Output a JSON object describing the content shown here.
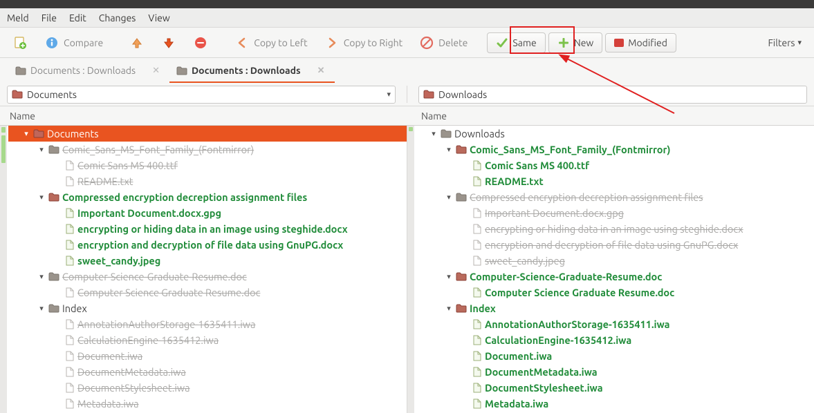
{
  "title": "Documents : Downloads",
  "menu": {
    "meld": "Meld",
    "file": "File",
    "edit": "Edit",
    "changes": "Changes",
    "view": "View"
  },
  "toolbar": {
    "compare": "Compare",
    "copy_left": "Copy to Left",
    "copy_right": "Copy to Right",
    "delete": "Delete",
    "same": "Same",
    "new": "New",
    "modified": "Modified",
    "filters": "Filters"
  },
  "tabs": [
    {
      "label": "Documents : Downloads",
      "active": false
    },
    {
      "label": "Documents : Downloads",
      "active": true
    }
  ],
  "paths": {
    "left": "Documents",
    "right": "Downloads"
  },
  "columns": {
    "name": "Name"
  },
  "left_tree": [
    {
      "depth": 0,
      "type": "folder",
      "exp": "▾",
      "label": "Documents",
      "cls": "rootsel"
    },
    {
      "depth": 1,
      "type": "folder",
      "exp": "▾",
      "label": "Comic_Sans_MS_Font_Family_(Fontmirror)",
      "cls": "ghost"
    },
    {
      "depth": 2,
      "type": "file",
      "exp": "",
      "label": "Comic Sans MS 400.ttf",
      "cls": "ghost"
    },
    {
      "depth": 2,
      "type": "file",
      "exp": "",
      "label": "README.txt",
      "cls": "ghost"
    },
    {
      "depth": 1,
      "type": "folder",
      "exp": "▾",
      "label": "Compressed encryption decreption assignment files",
      "cls": "green"
    },
    {
      "depth": 2,
      "type": "file",
      "exp": "",
      "label": "Important Document.docx.gpg",
      "cls": "green"
    },
    {
      "depth": 2,
      "type": "file",
      "exp": "",
      "label": "encrypting or hiding data in an image using steghide.docx",
      "cls": "green"
    },
    {
      "depth": 2,
      "type": "file",
      "exp": "",
      "label": "encryption and decryption of file data using GnuPG.docx",
      "cls": "green"
    },
    {
      "depth": 2,
      "type": "file",
      "exp": "",
      "label": "sweet_candy.jpeg",
      "cls": "green"
    },
    {
      "depth": 1,
      "type": "folder",
      "exp": "▾",
      "label": "Computer-Science-Graduate-Resume.doc",
      "cls": "ghost"
    },
    {
      "depth": 2,
      "type": "file",
      "exp": "",
      "label": "Computer Science Graduate Resume.doc",
      "cls": "ghost"
    },
    {
      "depth": 1,
      "type": "folder",
      "exp": "▾",
      "label": "Index",
      "cls": "normal"
    },
    {
      "depth": 2,
      "type": "file",
      "exp": "",
      "label": "AnnotationAuthorStorage-1635411.iwa",
      "cls": "ghost"
    },
    {
      "depth": 2,
      "type": "file",
      "exp": "",
      "label": "CalculationEngine-1635412.iwa",
      "cls": "ghost"
    },
    {
      "depth": 2,
      "type": "file",
      "exp": "",
      "label": "Document.iwa",
      "cls": "ghost"
    },
    {
      "depth": 2,
      "type": "file",
      "exp": "",
      "label": "DocumentMetadata.iwa",
      "cls": "ghost"
    },
    {
      "depth": 2,
      "type": "file",
      "exp": "",
      "label": "DocumentStylesheet.iwa",
      "cls": "ghost"
    },
    {
      "depth": 2,
      "type": "file",
      "exp": "",
      "label": "Metadata.iwa",
      "cls": "ghost"
    }
  ],
  "right_tree": [
    {
      "depth": 0,
      "type": "folder",
      "exp": "▾",
      "label": "Downloads",
      "cls": "normal"
    },
    {
      "depth": 1,
      "type": "folder",
      "exp": "▾",
      "label": "Comic_Sans_MS_Font_Family_(Fontmirror)",
      "cls": "green"
    },
    {
      "depth": 2,
      "type": "file",
      "exp": "",
      "label": "Comic Sans MS 400.ttf",
      "cls": "green"
    },
    {
      "depth": 2,
      "type": "file",
      "exp": "",
      "label": "README.txt",
      "cls": "green"
    },
    {
      "depth": 1,
      "type": "folder",
      "exp": "▾",
      "label": "Compressed encryption decreption assignment files",
      "cls": "ghost"
    },
    {
      "depth": 2,
      "type": "file",
      "exp": "",
      "label": "Important Document.docx.gpg",
      "cls": "ghost"
    },
    {
      "depth": 2,
      "type": "file",
      "exp": "",
      "label": "encrypting or hiding data in an image using steghide.docx",
      "cls": "ghost"
    },
    {
      "depth": 2,
      "type": "file",
      "exp": "",
      "label": "encryption and decryption of file data using GnuPG.docx",
      "cls": "ghost"
    },
    {
      "depth": 2,
      "type": "file",
      "exp": "",
      "label": "sweet_candy.jpeg",
      "cls": "ghost"
    },
    {
      "depth": 1,
      "type": "folder",
      "exp": "▾",
      "label": "Computer-Science-Graduate-Resume.doc",
      "cls": "green"
    },
    {
      "depth": 2,
      "type": "file",
      "exp": "",
      "label": "Computer Science Graduate Resume.doc",
      "cls": "green"
    },
    {
      "depth": 1,
      "type": "folder",
      "exp": "▾",
      "label": "Index",
      "cls": "green"
    },
    {
      "depth": 2,
      "type": "file",
      "exp": "",
      "label": "AnnotationAuthorStorage-1635411.iwa",
      "cls": "green"
    },
    {
      "depth": 2,
      "type": "file",
      "exp": "",
      "label": "CalculationEngine-1635412.iwa",
      "cls": "green"
    },
    {
      "depth": 2,
      "type": "file",
      "exp": "",
      "label": "Document.iwa",
      "cls": "green"
    },
    {
      "depth": 2,
      "type": "file",
      "exp": "",
      "label": "DocumentMetadata.iwa",
      "cls": "green"
    },
    {
      "depth": 2,
      "type": "file",
      "exp": "",
      "label": "DocumentStylesheet.iwa",
      "cls": "green"
    },
    {
      "depth": 2,
      "type": "file",
      "exp": "",
      "label": "Metadata.iwa",
      "cls": "green"
    }
  ]
}
